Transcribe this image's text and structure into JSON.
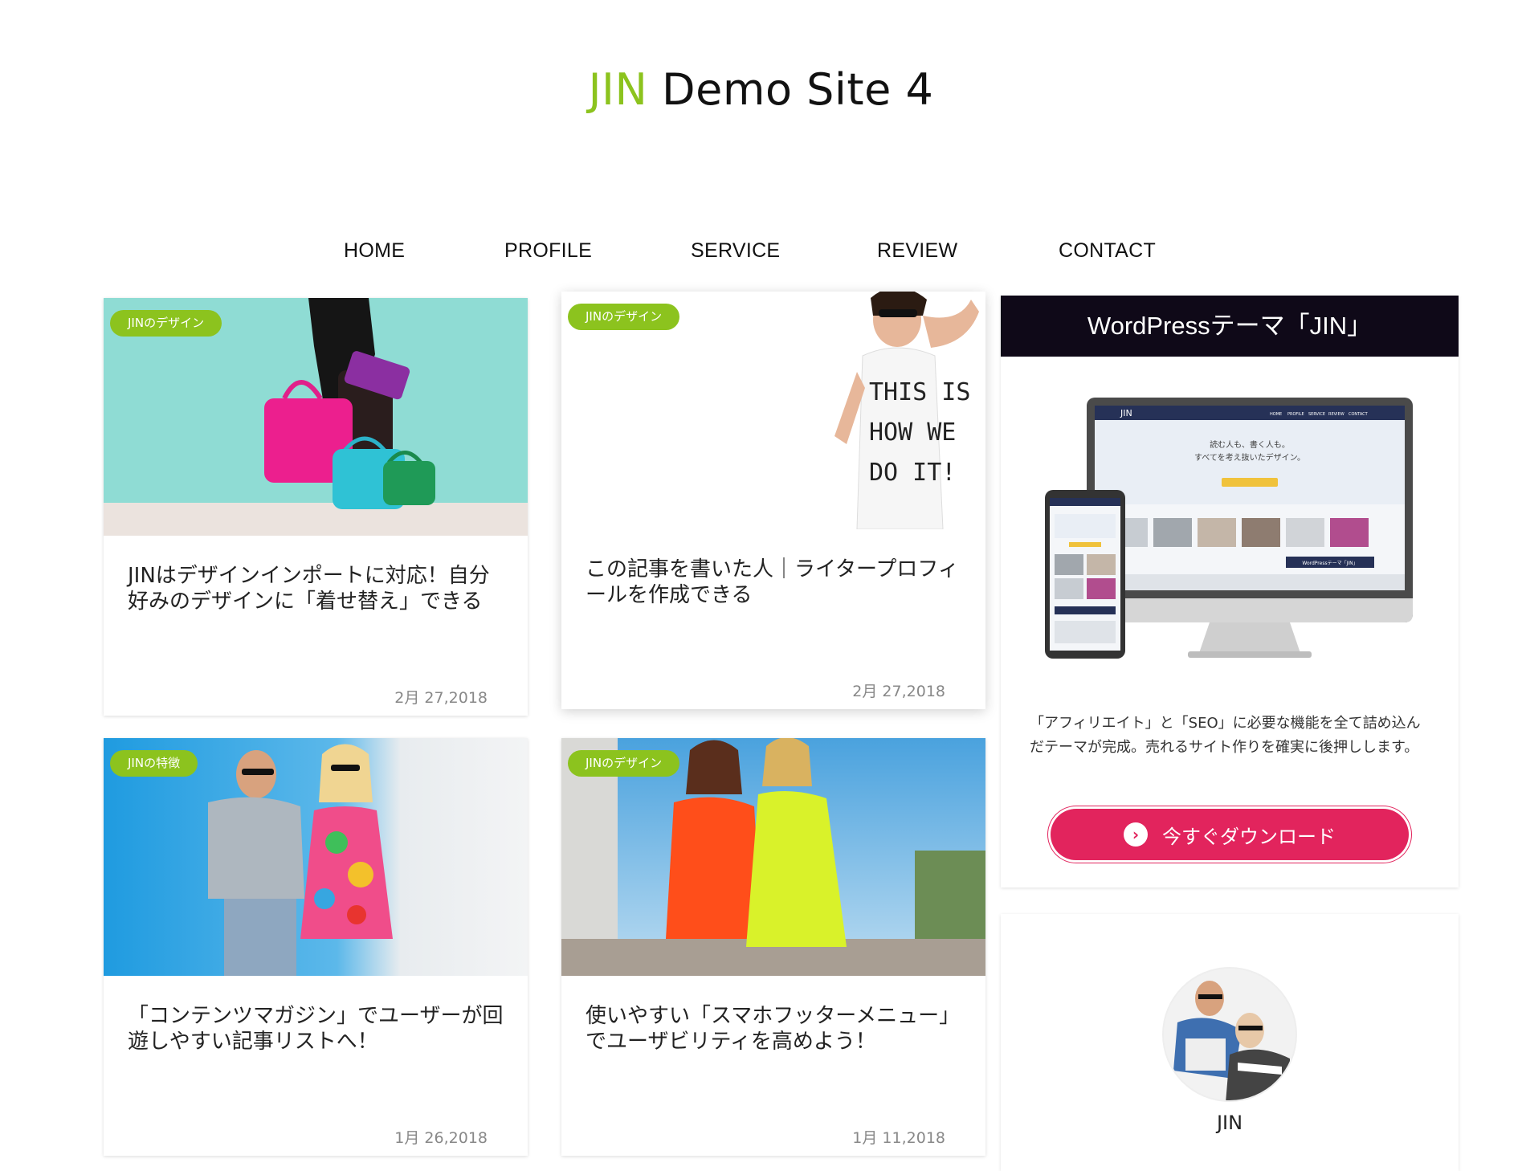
{
  "site": {
    "title_accent": "JIN",
    "title_rest": " Demo Site 4"
  },
  "nav": {
    "items": [
      "HOME",
      "PROFILE",
      "SERVICE",
      "REVIEW",
      "CONTACT"
    ]
  },
  "posts": [
    {
      "badge": "JINのデザイン",
      "title": "JINはデザインインポートに対応！自分好みのデザインに「着せ替え」できる",
      "date": "2月 27,2018"
    },
    {
      "badge": "JINのデザイン",
      "title": "この記事を書いた人｜ライタープロフィールを作成できる",
      "date": "2月 27,2018"
    },
    {
      "badge": "JINの特徴",
      "title": "「コンテンツマガジン」でユーザーが回遊しやすい記事リストへ！",
      "date": "1月 26,2018"
    },
    {
      "badge": "JINのデザイン",
      "title": "使いやすい「スマホフッターメニュー」でユーザビリティを高めよう！",
      "date": "1月 11,2018"
    }
  ],
  "widget": {
    "heading": "WordPressテーマ「JIN」",
    "description": "「アフィリエイト」と「SEO」に必要な機能を全て詰め込んだテーマが完成。売れるサイト作りを確実に後押しします。",
    "button_label": "今すぐダウンロード",
    "mock_logo": "JIN",
    "mock_nav": [
      "HOME",
      "PROFILE",
      "SERVICE",
      "REVIEW",
      "CONTACT"
    ],
    "mock_hero_line1": "読む人も、書く人も。",
    "mock_hero_line2": "すべてを考え抜いたデザイン。",
    "mock_tab": "WordPressテーマ「JIN」"
  },
  "profile": {
    "name": "JIN"
  },
  "colors": {
    "accent": "#8cc31e",
    "button": "#e2245d",
    "widget_head": "#0f0918"
  }
}
